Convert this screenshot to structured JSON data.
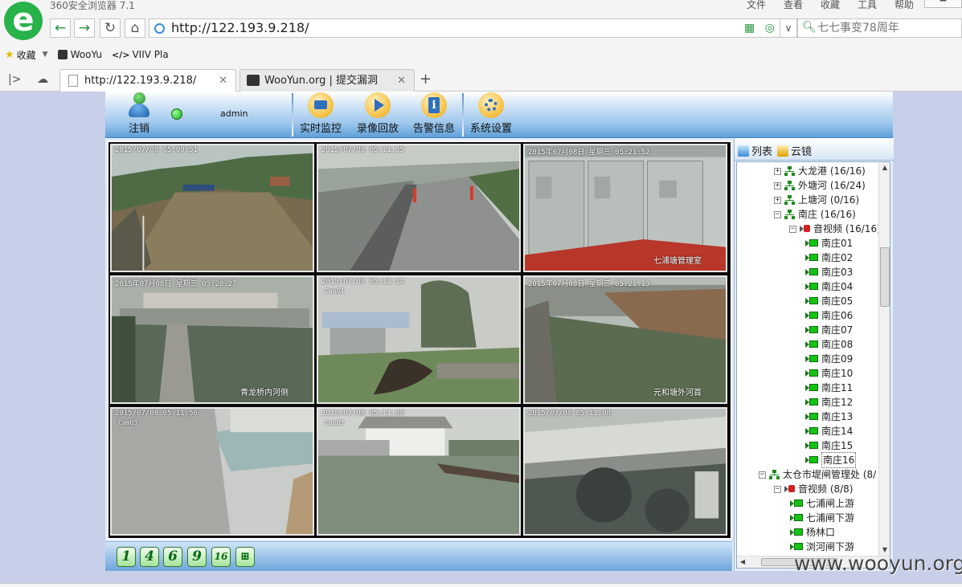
{
  "browser": {
    "app_title": "360安全浏览器 7.1",
    "logo_letter": "e",
    "menu": [
      "文件",
      "查看",
      "收藏",
      "工具",
      "帮助"
    ],
    "address_url": "http://122.193.9.218/",
    "search_placeholder": "七七事变78周年",
    "bookmarks": [
      "收藏",
      "WooYu",
      "VIIV Pla"
    ],
    "tabs": [
      {
        "title": "http://122.193.9.218/",
        "active": true
      },
      {
        "title": "WooYun.org | 提交漏洞",
        "active": false
      }
    ]
  },
  "app": {
    "user": {
      "logout_label": "注销",
      "username": "admin"
    },
    "toolbar": [
      {
        "label": "实时监控",
        "icon": "monitor-icon"
      },
      {
        "label": "录像回放",
        "icon": "playback-icon"
      },
      {
        "label": "告警信息",
        "icon": "alarm-info-icon"
      },
      {
        "label": "系统设置",
        "icon": "settings-icon"
      }
    ],
    "cameras": [
      {
        "timestamp": "2015/07/08 05:09:51",
        "cam_id": "",
        "location": ""
      },
      {
        "timestamp": "2015/07/08 05:11:35",
        "cam_id": "",
        "location": ""
      },
      {
        "timestamp": "2015年07月08日 星期三 05:21:52",
        "cam_id": "",
        "location": "七浦塘管理室"
      },
      {
        "timestamp": "2015年07月08日 星期三 05:20:27",
        "cam_id": "",
        "location": "青龙桥内河侧"
      },
      {
        "timestamp": "2015/07/08 05:12:14",
        "cam_id": "Cam04",
        "location": ""
      },
      {
        "timestamp": "2015年07月08日 星期三 05:21:13",
        "cam_id": "",
        "location": "元和塘外河首"
      },
      {
        "timestamp": "2015/07/08 05:11:56",
        "cam_id": "Cam03",
        "location": ""
      },
      {
        "timestamp": "2015/07/08 05:11:38",
        "cam_id": "Cam03",
        "location": ""
      },
      {
        "timestamp": "2015/07/08 05:11:08",
        "cam_id": "",
        "location": ""
      }
    ],
    "layout_buttons": [
      "1",
      "4",
      "6",
      "9",
      "16"
    ],
    "panel": {
      "tab_list": "列表",
      "tab_cloud": "云镜",
      "tree": [
        {
          "label": "大龙港 (16/16)",
          "type": "org",
          "expander": "+"
        },
        {
          "label": "外塘河 (16/24)",
          "type": "org",
          "expander": "+"
        },
        {
          "label": "上塘河 (0/16)",
          "type": "org",
          "expander": "+"
        },
        {
          "label": "南庄 (16/16)",
          "type": "org",
          "expander": "−"
        },
        {
          "label": "音视频 (16/16)",
          "type": "av",
          "expander": "−"
        },
        {
          "label": "南庄01",
          "type": "cam"
        },
        {
          "label": "南庄02",
          "type": "cam"
        },
        {
          "label": "南庄03",
          "type": "cam"
        },
        {
          "label": "南庄04",
          "type": "cam"
        },
        {
          "label": "南庄05",
          "type": "cam"
        },
        {
          "label": "南庄06",
          "type": "cam"
        },
        {
          "label": "南庄07",
          "type": "cam"
        },
        {
          "label": "南庄08",
          "type": "cam"
        },
        {
          "label": "南庄09",
          "type": "cam"
        },
        {
          "label": "南庄10",
          "type": "cam"
        },
        {
          "label": "南庄11",
          "type": "cam"
        },
        {
          "label": "南庄12",
          "type": "cam"
        },
        {
          "label": "南庄13",
          "type": "cam"
        },
        {
          "label": "南庄14",
          "type": "cam"
        },
        {
          "label": "南庄15",
          "type": "cam"
        },
        {
          "label": "南庄16",
          "type": "cam",
          "selected": true
        },
        {
          "label": "太仓市堤闸管理处 (8/",
          "type": "org",
          "expander": "−"
        },
        {
          "label": "音视频 (8/8)",
          "type": "av",
          "expander": "−"
        },
        {
          "label": "七浦闸上游",
          "type": "cam"
        },
        {
          "label": "七浦闸下游",
          "type": "cam"
        },
        {
          "label": "杨林口",
          "type": "cam"
        },
        {
          "label": "浏河闸下游",
          "type": "cam"
        }
      ]
    }
  },
  "watermark": "www.wooyun.org",
  "colors": {
    "accent_green": "#27b24a",
    "toolbar_blue": "#5f9fd8",
    "status_green": "#10b010"
  }
}
